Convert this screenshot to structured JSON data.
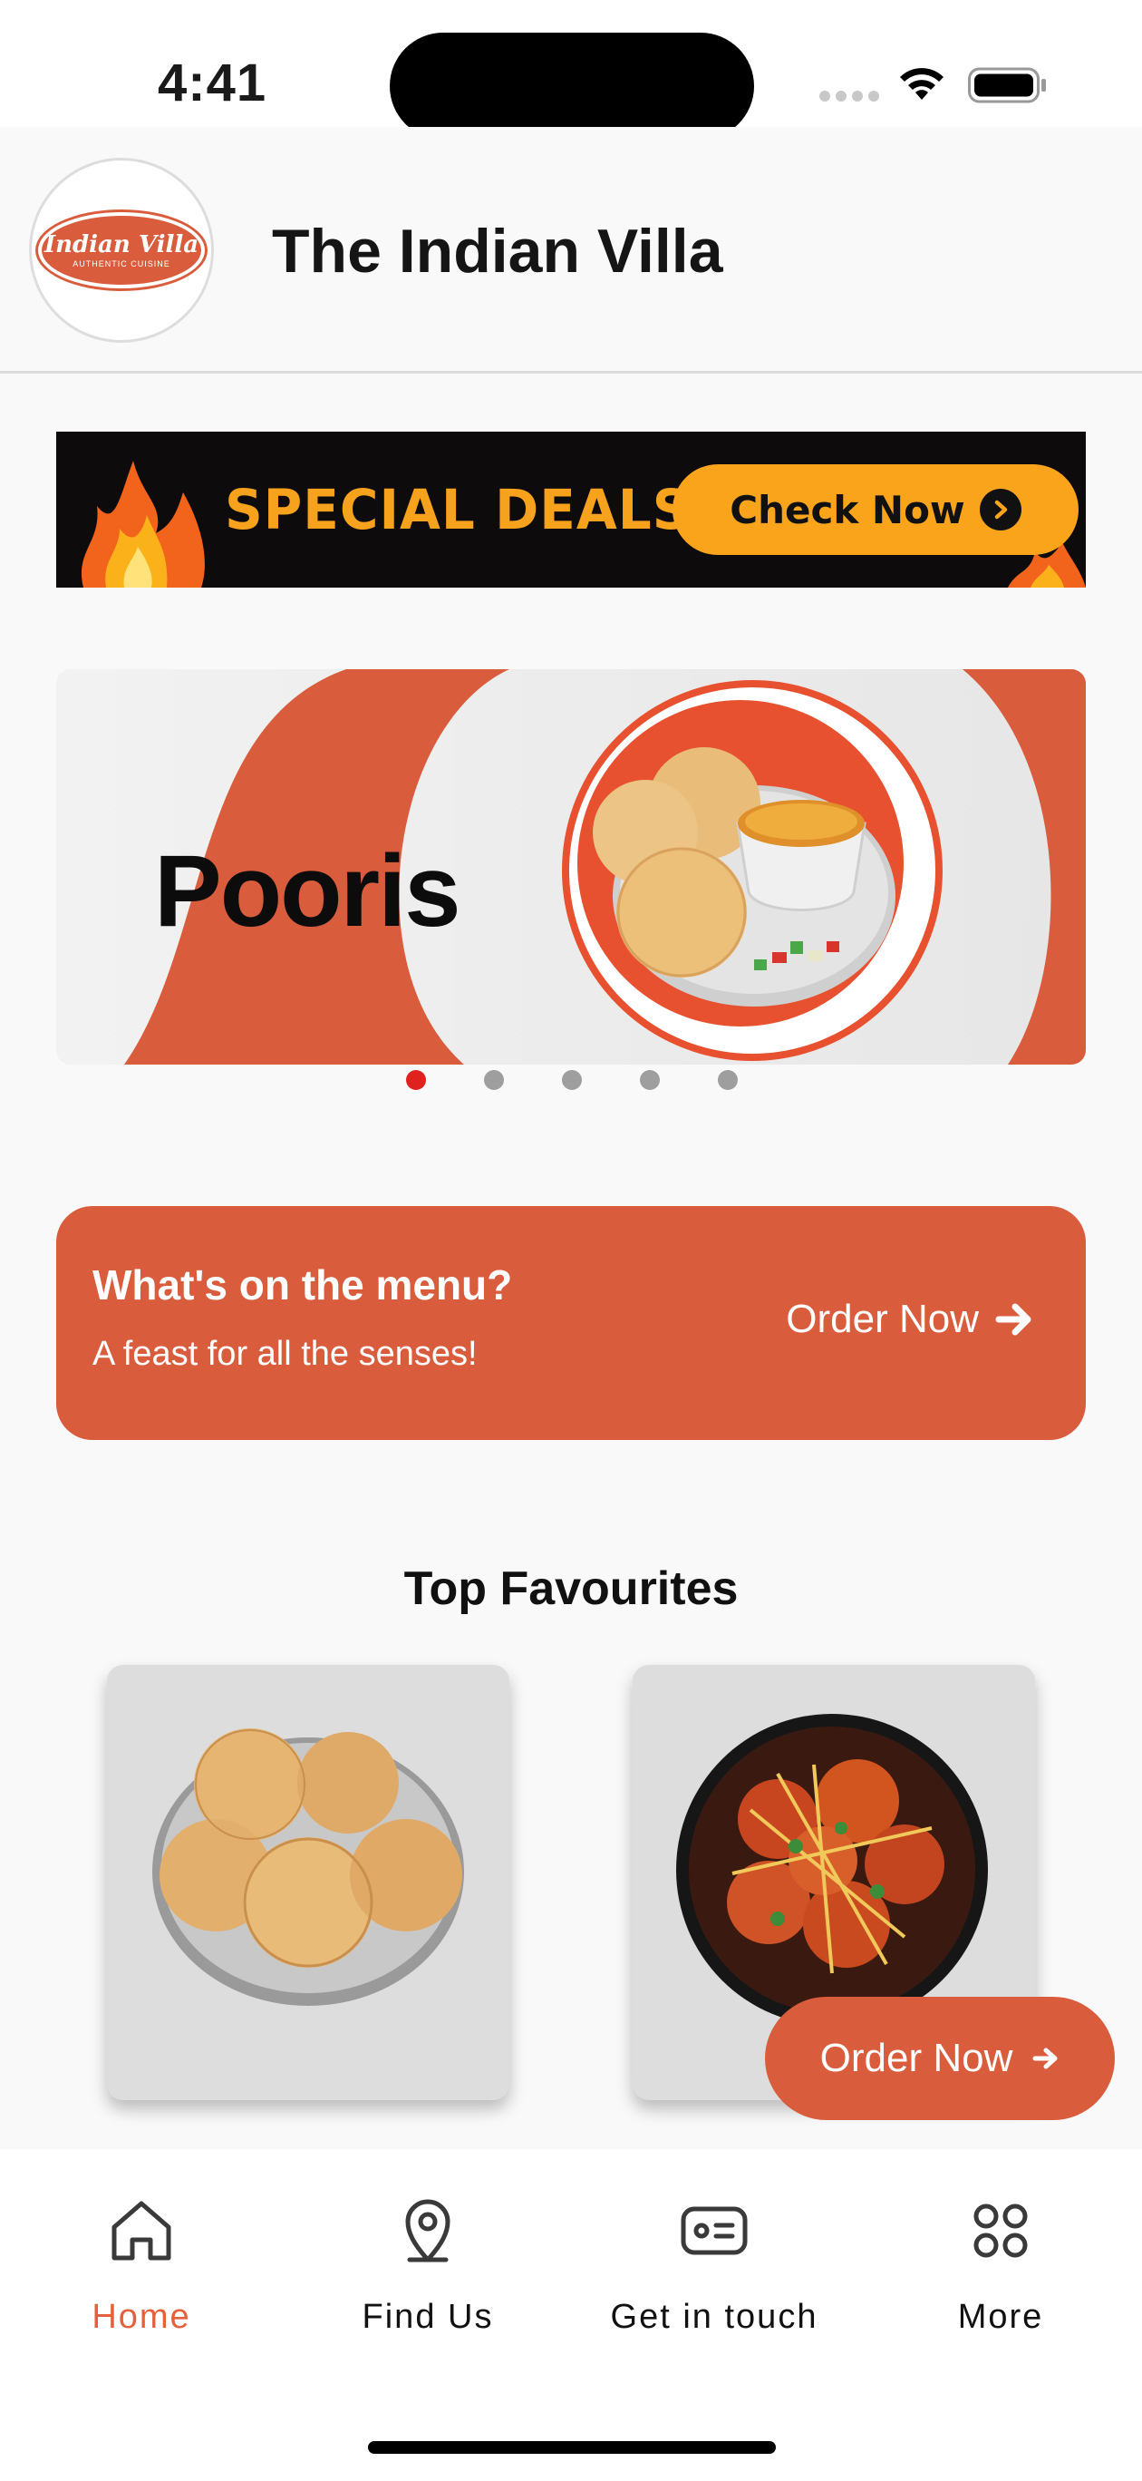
{
  "status_bar": {
    "time": "4:41"
  },
  "header": {
    "logo": {
      "name": "Indian Villa",
      "tagline": "AUTHENTIC CUISINE"
    },
    "title": "The Indian Villa"
  },
  "deals_banner": {
    "text": "SPECIAL DEALS",
    "button_label": "Check Now"
  },
  "carousel": {
    "slides": [
      {
        "title": "Pooris"
      }
    ],
    "active_index": 0,
    "slide_count": 5,
    "accent": "#d95d3c"
  },
  "menu_card": {
    "title": "What's on the menu?",
    "subtitle": "A feast for all the senses!",
    "action_label": "Order Now"
  },
  "favourites": {
    "heading": "Top Favourites",
    "items": [
      {
        "icon": "pooris-image"
      },
      {
        "icon": "chicken-curry-image"
      }
    ]
  },
  "floating_order": {
    "label": "Order Now"
  },
  "bottom_nav": {
    "items": [
      {
        "label": "Home",
        "icon": "home-icon",
        "active": true
      },
      {
        "label": "Find Us",
        "icon": "location-pin-icon",
        "active": false
      },
      {
        "label": "Get in touch",
        "icon": "contact-card-icon",
        "active": false
      },
      {
        "label": "More",
        "icon": "grid-icon",
        "active": false
      }
    ]
  },
  "colors": {
    "brand": "#d95d3c",
    "active_nav": "#e5613b",
    "deal_yellow": "#f9a41a",
    "active_dot": "#e0221f"
  }
}
